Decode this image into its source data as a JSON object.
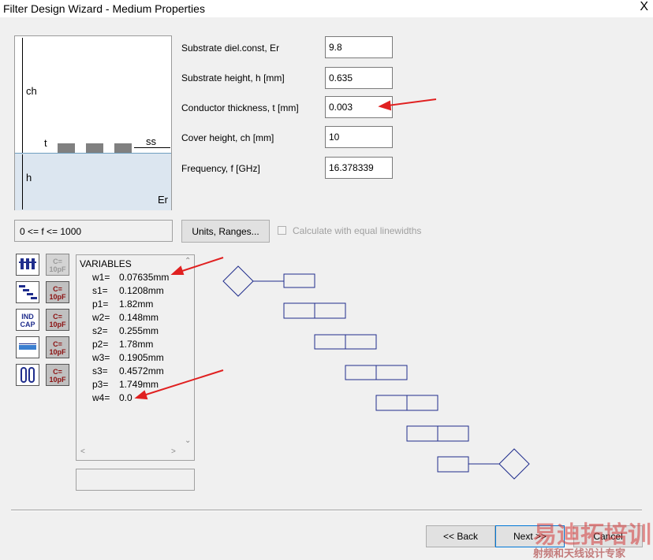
{
  "window": {
    "title": "Filter Design Wizard - Medium Properties",
    "close_glyph": "X"
  },
  "diagram": {
    "ch": "ch",
    "t": "t",
    "ss": "ss",
    "h": "h",
    "er": "Er"
  },
  "properties": [
    {
      "label": "Substrate diel.const, Er",
      "value": "9.8"
    },
    {
      "label": "Substrate height, h [mm]",
      "value": "0.635"
    },
    {
      "label": "Conductor thickness, t [mm]",
      "value": "0.003"
    },
    {
      "label": "Cover height, ch [mm]",
      "value": "10"
    },
    {
      "label": "Frequency, f [GHz]",
      "value": "16.378339"
    }
  ],
  "status_text": "0 <= f <= 1000",
  "units_button": "Units, Ranges...",
  "equal_linewidths_label": "Calculate with equal linewidths",
  "tools": [
    {
      "icon": "coupled-lines-icon",
      "text": ""
    },
    {
      "icon": "capacitor-c10pf-icon",
      "text": "C=\n10pF"
    },
    {
      "icon": "stepped-lines-icon",
      "text": ""
    },
    {
      "icon": "capacitor-c10pf-icon",
      "text": "C=\n10pF"
    },
    {
      "icon": "ind-cap-icon",
      "text": "IND\nCAP"
    },
    {
      "icon": "capacitor-c10pf-icon",
      "text": "C=\n10pF"
    },
    {
      "icon": "ruler-icon",
      "text": ""
    },
    {
      "icon": "capacitor-c10pf-icon",
      "text": "C=\n10pF"
    },
    {
      "icon": "resonator-icon",
      "text": ""
    },
    {
      "icon": "capacitor-c10pf-icon",
      "text": "C=\n10pF"
    }
  ],
  "variables": {
    "title": "VARIABLES",
    "items": [
      {
        "name": "w1=",
        "value": "0.07635mm"
      },
      {
        "name": "s1=",
        "value": "0.1208mm"
      },
      {
        "name": "p1=",
        "value": "1.82mm"
      },
      {
        "name": "w2=",
        "value": "0.148mm"
      },
      {
        "name": "s2=",
        "value": "0.255mm"
      },
      {
        "name": "p2=",
        "value": "1.78mm"
      },
      {
        "name": "w3=",
        "value": "0.1905mm"
      },
      {
        "name": "s3=",
        "value": "0.4572mm"
      },
      {
        "name": "p3=",
        "value": "1.749mm"
      },
      {
        "name": "w4=",
        "value": "0.0"
      }
    ]
  },
  "buttons": {
    "back": "<< Back",
    "next": "Next >>",
    "cancel": "Cancel"
  },
  "watermark": {
    "line1": "易迪拓培训",
    "line2": "射频和天线设计专家"
  },
  "colors": {
    "annotation": "#e02020",
    "schematic": "#1f2d8c",
    "substrate": "#dce6f0"
  }
}
